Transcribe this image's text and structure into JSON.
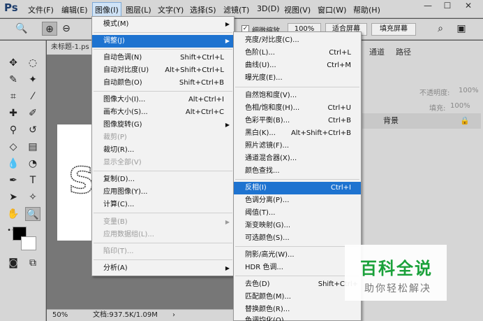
{
  "app": {
    "logo": "Ps"
  },
  "menubar": {
    "file": "文件(F)",
    "edit": "编辑(E)",
    "image": "图像(I)",
    "layer": "图层(L)",
    "type": "文字(Y)",
    "select": "选择(S)",
    "filter": "滤镜(T)",
    "3d": "3D(D)",
    "view": "视图(V)",
    "window": "窗口(W)",
    "help": "帮助(H)"
  },
  "window_controls": {
    "minimize": "—",
    "restore": "☐",
    "close": "✕"
  },
  "options_bar": {
    "scrubby_zoom": "细微缩放",
    "zoom_100": "100%",
    "fit_screen": "适合屏幕",
    "fill_screen": "填充屏幕"
  },
  "document": {
    "tab_title": "未标题-1.ps",
    "zoom": "50%",
    "doc_info": "文档:937.5K/1.09M"
  },
  "right_panel": {
    "channels_tab": "通道",
    "paths_tab": "路径",
    "opacity_label": "不透明度:",
    "opacity_value": "100%",
    "fill_label": "填充:",
    "fill_value": "100%",
    "layer_name": "背景"
  },
  "image_menu": {
    "mode": "模式(M)",
    "adjustments": "调整(J)",
    "auto_tone": "自动色调(N)",
    "auto_tone_sc": "Shift+Ctrl+L",
    "auto_contrast": "自动对比度(U)",
    "auto_contrast_sc": "Alt+Shift+Ctrl+L",
    "auto_color": "自动颜色(O)",
    "auto_color_sc": "Shift+Ctrl+B",
    "image_size": "图像大小(I)...",
    "image_size_sc": "Alt+Ctrl+I",
    "canvas_size": "画布大小(S)...",
    "canvas_size_sc": "Alt+Ctrl+C",
    "image_rotation": "图像旋转(G)",
    "crop": "裁剪(P)",
    "trim": "裁切(R)...",
    "reveal_all": "显示全部(V)",
    "duplicate": "复制(D)...",
    "apply_image": "应用图像(Y)...",
    "calculations": "计算(C)...",
    "variables": "变量(B)",
    "apply_data_set": "应用数据组(L)...",
    "trap": "陷印(T)...",
    "analysis": "分析(A)"
  },
  "adjust_menu": {
    "brightness_contrast": "亮度/对比度(C)...",
    "levels": "色阶(L)...",
    "levels_sc": "Ctrl+L",
    "curves": "曲线(U)...",
    "curves_sc": "Ctrl+M",
    "exposure": "曝光度(E)...",
    "vibrance": "自然饱和度(V)...",
    "hue_saturation": "色相/饱和度(H)...",
    "hue_saturation_sc": "Ctrl+U",
    "color_balance": "色彩平衡(B)...",
    "color_balance_sc": "Ctrl+B",
    "black_white": "黑白(K)...",
    "black_white_sc": "Alt+Shift+Ctrl+B",
    "photo_filter": "照片滤镜(F)...",
    "channel_mixer": "通道混合器(X)...",
    "color_lookup": "颜色查找...",
    "invert": "反相(I)",
    "invert_sc": "Ctrl+I",
    "posterize": "色调分离(P)...",
    "threshold": "阈值(T)...",
    "gradient_map": "渐变映射(G)...",
    "selective_color": "可选颜色(S)...",
    "shadows_highlights": "阴影/高光(W)...",
    "hdr_toning": "HDR 色调...",
    "desaturate": "去色(D)",
    "desaturate_sc": "Shift+Ctrl+",
    "match_color": "匹配颜色(M)...",
    "replace_color": "替换颜色(R)...",
    "equalize": "色调均化(Q)"
  },
  "watermark": {
    "title": "百科全说",
    "subtitle": "助你轻松解决"
  },
  "colors": {
    "highlight": "#1e73d0",
    "menu_bg": "#f2f2f2",
    "chrome": "#d6d6d6",
    "workspace": "#535353"
  }
}
